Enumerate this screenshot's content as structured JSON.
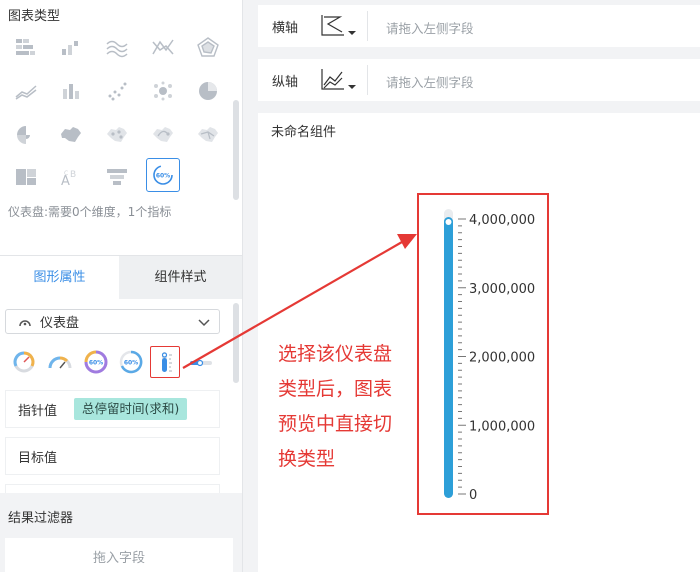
{
  "left_panel": {
    "chart_type_title": "图表类型",
    "chart_type_hint": "仪表盘:需要0个维度，1个指标",
    "chart_types": [
      "heatmap-table-icon",
      "bar-chart-icon",
      "area-wave-icon",
      "line-cross-icon",
      "radar-icon",
      "line-chart-icon",
      "stacked-bar-icon",
      "scatter-icon",
      "bubble-icon",
      "pie-chart-icon",
      "rose-chart-icon",
      "china-map-icon",
      "map-dots-icon",
      "map-flow-icon",
      "map-network-icon",
      "treemap-icon",
      "wordcloud-icon",
      "funnel-icon",
      "gauge-icon"
    ],
    "tabs": {
      "shape": "图形属性",
      "style": "组件样式"
    },
    "gauge_select": "仪表盘",
    "gauge_variants": [
      "speedometer-icon",
      "semi-gauge-icon",
      "ring-gauge-icon",
      "ring-gauge-2-icon",
      "thermometer-icon",
      "slider-gauge-icon"
    ],
    "pointer_label": "指针值",
    "pointer_value": "总停留时间(求和)",
    "target_label": "目标值",
    "filter_title": "结果过滤器",
    "drag_placeholder": "拖入字段"
  },
  "axes": {
    "x_label": "横轴",
    "y_label": "纵轴",
    "placeholder": "请拖入左侧字段"
  },
  "preview": {
    "component_name": "未命名组件",
    "annotation_lines": [
      "选择该仪表盘",
      "类型后，图表",
      "预览中直接切",
      "换类型"
    ]
  },
  "colors": {
    "accent": "#3a8ee6",
    "gauge_bar": "#2d9fd8",
    "annotation": "#e53935",
    "pill": "#a8e6dd"
  },
  "chart_data": {
    "type": "bar",
    "orientation": "vertical-thermometer",
    "tick_labels": [
      "4,000,000",
      "3,000,000",
      "2,000,000",
      "1,000,000",
      "0"
    ],
    "ylim": [
      0,
      4000000
    ],
    "values": [
      4000000
    ]
  }
}
